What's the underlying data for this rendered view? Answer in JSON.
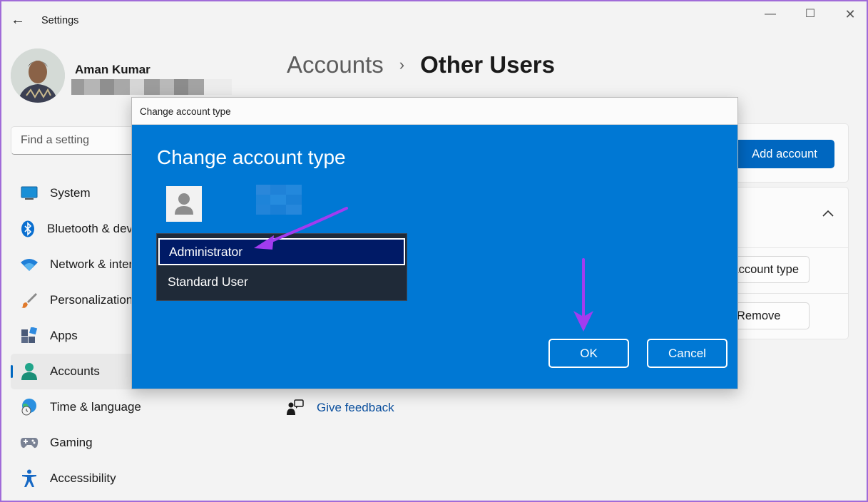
{
  "window": {
    "title": "Settings",
    "back_icon": "back-arrow-icon",
    "controls": [
      "minimize-icon",
      "maximize-icon",
      "close-icon"
    ]
  },
  "user": {
    "name": "Aman Kumar"
  },
  "search": {
    "placeholder": "Find a setting"
  },
  "sidebar": {
    "items": [
      {
        "label": "System",
        "icon": "monitor-icon"
      },
      {
        "label": "Bluetooth & devices",
        "icon": "bluetooth-icon"
      },
      {
        "label": "Network & internet",
        "icon": "wifi-icon"
      },
      {
        "label": "Personalization",
        "icon": "brush-icon"
      },
      {
        "label": "Apps",
        "icon": "apps-icon"
      },
      {
        "label": "Accounts",
        "icon": "person-icon",
        "active": true
      },
      {
        "label": "Time & language",
        "icon": "globe-clock-icon"
      },
      {
        "label": "Gaming",
        "icon": "gamepad-icon"
      },
      {
        "label": "Accessibility",
        "icon": "accessibility-icon"
      }
    ]
  },
  "breadcrumb": {
    "parent": "Accounts",
    "current": "Other Users"
  },
  "main": {
    "add_account_label": "Add account",
    "change_account_type_label": "Change account type",
    "remove_label": "Remove",
    "feedback_label": "Give feedback"
  },
  "dialog": {
    "title": "Change account type",
    "heading": "Change account type",
    "options": [
      "Administrator",
      "Standard User"
    ],
    "selected": "Administrator",
    "ok_label": "OK",
    "cancel_label": "Cancel"
  },
  "colors": {
    "accent": "#0067c0",
    "dialog_blue": "#0078d4",
    "annotation_arrow": "#a23cf0",
    "border_frame": "#a06bd8"
  }
}
